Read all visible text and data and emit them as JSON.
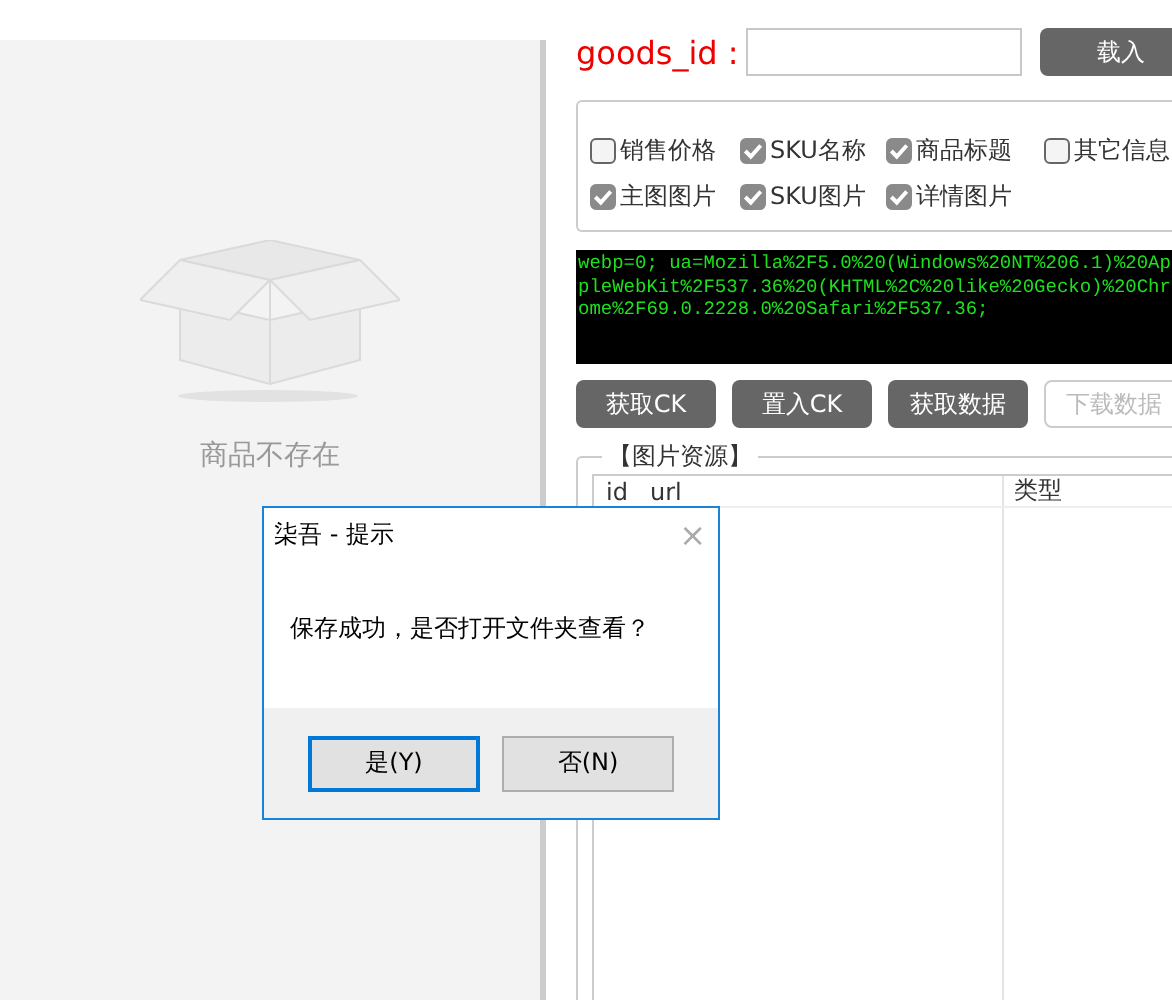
{
  "preview": {
    "message": "商品不存在"
  },
  "goods_id": {
    "label": "goods_id :",
    "load_button": "载入"
  },
  "options": [
    {
      "label": "销售价格",
      "checked": false
    },
    {
      "label": "SKU名称",
      "checked": true
    },
    {
      "label": "商品标题",
      "checked": true
    },
    {
      "label": "其它信息",
      "checked": false
    },
    {
      "label": "主图图片",
      "checked": true
    },
    {
      "label": "SKU图片",
      "checked": true
    },
    {
      "label": "详情图片",
      "checked": true
    }
  ],
  "cookie_text": "webp=0; ua=Mozilla%2F5.0%20(Windows%20NT%206.1)%20AppleWebKit%2F537.36%20(KHTML%2C%20like%20Gecko)%20Chrome%2F69.0.2228.0%20Safari%2F537.36;",
  "actions": [
    {
      "label": "获取CK",
      "disabled": false
    },
    {
      "label": "置入CK",
      "disabled": false
    },
    {
      "label": "获取数据",
      "disabled": false
    },
    {
      "label": "下载数据",
      "disabled": true
    }
  ],
  "images": {
    "title": "【图片资源】",
    "columns": [
      "id",
      "url",
      "类型"
    ]
  },
  "dialog": {
    "title": "柒吾 - 提示",
    "close": "×",
    "message": "保存成功，是否打开文件夹查看？",
    "buttons": [
      {
        "label": "是(Y)",
        "selected": true
      },
      {
        "label": "否(N)",
        "selected": false
      }
    ]
  }
}
